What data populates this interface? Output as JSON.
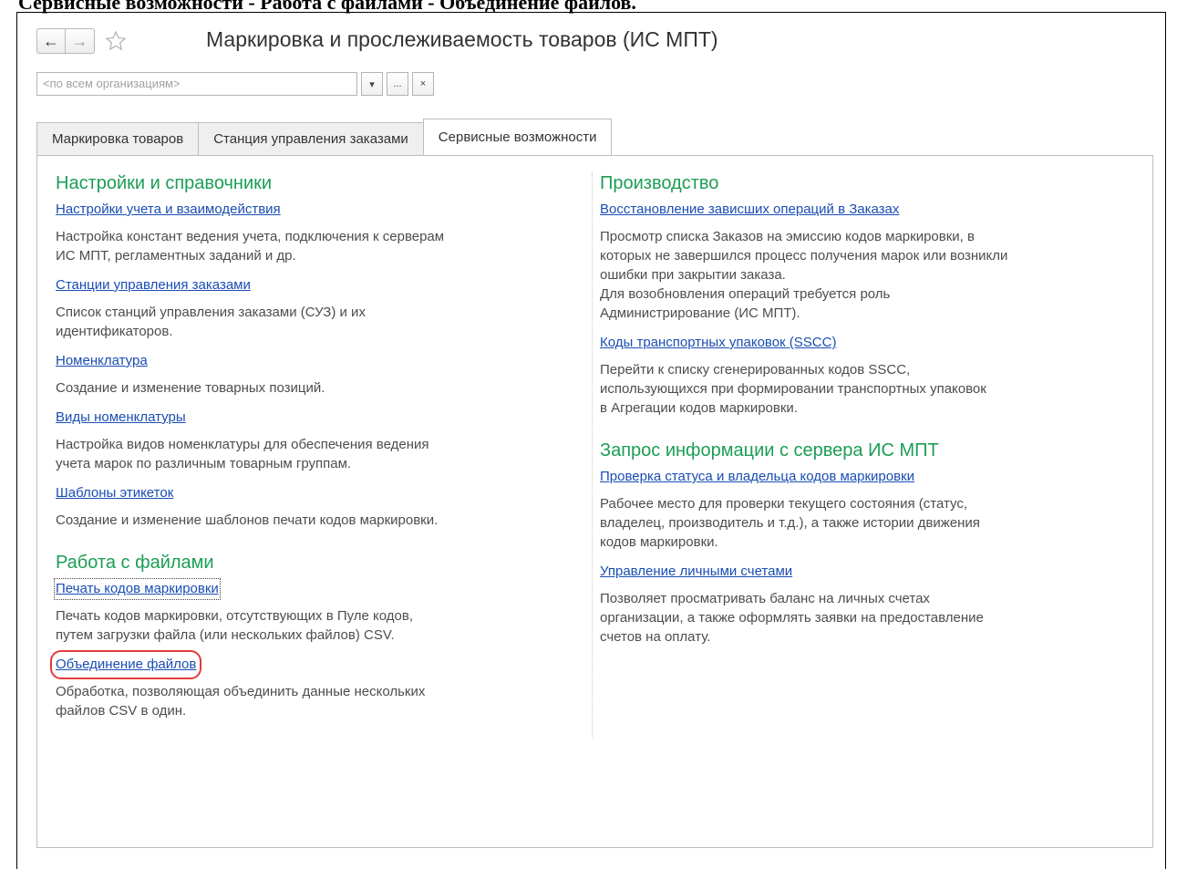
{
  "doc_heading": "Сервисные возможности - Работа с файлами - Объединение файлов.",
  "window": {
    "title": "Маркировка и прослеживаемость товаров (ИС МПТ)"
  },
  "org_selector": {
    "placeholder": "<по всем организациям>",
    "dropdown_glyph": "▾",
    "more_glyph": "...",
    "clear_glyph": "×"
  },
  "tabs": [
    {
      "label": "Маркировка товаров",
      "active": false
    },
    {
      "label": "Станция управления заказами",
      "active": false
    },
    {
      "label": "Сервисные возможности",
      "active": true
    }
  ],
  "left": {
    "sections": [
      {
        "title": "Настройки и справочники",
        "items": [
          {
            "link": "Настройки учета и взаимодействия",
            "lines": [
              "Настройка констант ведения учета, подключения к серверам",
              "ИС МПТ, регламентных заданий и др."
            ]
          },
          {
            "link": "Станции управления заказами",
            "lines": [
              "Список станций управления заказами (СУЗ) и их",
              "идентификаторов."
            ]
          },
          {
            "link": "Номенклатура",
            "lines": [
              "Создание и изменение товарных позиций."
            ]
          },
          {
            "link": "Виды номенклатуры",
            "lines": [
              "Настройка видов номенклатуры для обеспечения ведения",
              "учета марок по различным товарным группам."
            ]
          },
          {
            "link": "Шаблоны этикеток",
            "lines": [
              "Создание и изменение шаблонов печати кодов маркировки."
            ]
          }
        ]
      },
      {
        "title": "Работа с файлами",
        "items": [
          {
            "link": "Печать кодов маркировки",
            "lines": [
              "Печать кодов маркировки, отсутствующих в Пуле кодов,",
              "путем загрузки файла (или нескольких файлов) CSV."
            ]
          },
          {
            "link": "Объединение файлов",
            "lines": [
              "Обработка, позволяющая объединить данные нескольких",
              "файлов CSV в один."
            ]
          }
        ]
      }
    ]
  },
  "right": {
    "sections": [
      {
        "title": "Производство",
        "items": [
          {
            "link": "Восстановление зависших операций в Заказах",
            "lines": [
              "Просмотр списка Заказов на эмиссию кодов маркировки, в",
              "которых не завершился процесс получения марок или возникли",
              "ошибки при закрытии заказа.",
              "Для возобновления операций требуется роль",
              "Администрирование (ИС МПТ)."
            ]
          },
          {
            "link": "Коды транспортных упаковок (SSCC)",
            "lines": [
              "Перейти к списку сгенерированных кодов SSCC,",
              "использующихся при формировании транспортных упаковок",
              "в Агрегации кодов маркировки."
            ]
          }
        ]
      },
      {
        "title": "Запрос информации с сервера ИС МПТ",
        "items": [
          {
            "link": "Проверка статуса и владельца кодов маркировки",
            "lines": [
              "Рабочее место для проверки текущего состояния (статус,",
              "владелец, производитель и т.д.), а также истории движения",
              "кодов маркировки."
            ]
          },
          {
            "link": "Управление личными счетами",
            "lines": [
              "Позволяет просматривать баланс на личных счетах",
              "организации, а также оформлять заявки на предоставление",
              "счетов на оплату."
            ]
          }
        ]
      }
    ]
  },
  "highlight_color": "#e23a3a",
  "accent_green": "#1b9e54",
  "link_blue": "#1a4db3"
}
